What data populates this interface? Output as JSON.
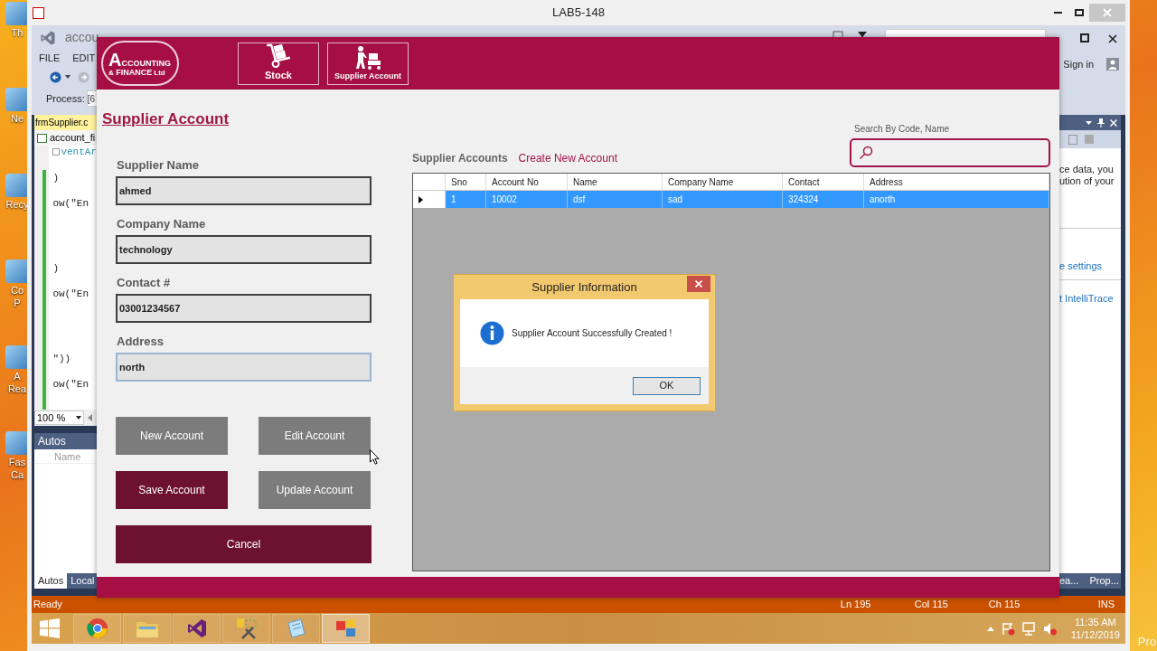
{
  "host_desktop": {
    "icons": [
      {
        "label": "Th"
      },
      {
        "label": "Ne"
      },
      {
        "label": "Recy"
      },
      {
        "label": "Co\nP"
      },
      {
        "label": "A\nRea"
      },
      {
        "label": "Fas\nCa"
      }
    ],
    "corner_text": "Pro"
  },
  "vm_window": {
    "title": "LAB5-148"
  },
  "ide": {
    "title": "accou",
    "menu": [
      "FILE",
      "EDIT"
    ],
    "sign_in": "Sign in",
    "process_label": "Process:",
    "process_value": "[6",
    "document_tab": "frmSupplier.c",
    "file_dropdown": "account_fi",
    "code_lines": [
      "ventAr",
      ")",
      "ow(\"En",
      ")",
      "ow(\"En",
      "\"))",
      "ow(\"En"
    ],
    "zoom": "100 %",
    "autos": {
      "title": "Autos",
      "column": "Name"
    },
    "bottom_tabs": [
      {
        "label": "Autos",
        "selected": true
      },
      {
        "label": "Local",
        "selected": false
      }
    ],
    "right_panel": {
      "lines": [
        "ce data, you",
        "ution of your"
      ],
      "links": [
        "e settings",
        "t IntelliTrace"
      ],
      "tabs": [
        "ea...",
        "Prop..."
      ]
    },
    "status_bar": {
      "state": "Ready",
      "line": "Ln 195",
      "column": "Col 115",
      "char": "Ch 115",
      "mode": "INS"
    }
  },
  "taskbar": {
    "apps": [
      {
        "kind": "chrome",
        "active": false
      },
      {
        "kind": "explorer",
        "active": false
      },
      {
        "kind": "visual-studio",
        "active": false
      },
      {
        "kind": "tools",
        "active": false
      },
      {
        "kind": "notepad",
        "active": false
      },
      {
        "kind": "windows-app",
        "active": true
      }
    ],
    "time": "11:35 AM",
    "date": "11/12/2019"
  },
  "app": {
    "logo": {
      "line_1": "ACCOUNTING",
      "symbol": "&",
      "line_2": "FINANCE",
      "suffix": "Ltd"
    },
    "nav": [
      {
        "kind": "stock",
        "label": "Stock"
      },
      {
        "kind": "supplier",
        "label": "Supplier Account"
      }
    ],
    "page_title": "Supplier Account",
    "fields": [
      {
        "label": "Supplier Name",
        "value": "ahmed",
        "focused": false
      },
      {
        "label": "Company Name",
        "value": "technology",
        "focused": false
      },
      {
        "label": "Contact #",
        "value": "03001234567",
        "focused": false
      },
      {
        "label": "Address",
        "value": "north",
        "focused": true
      }
    ],
    "buttons": [
      {
        "label": "New Account",
        "disabled": true
      },
      {
        "label": "Edit Account",
        "disabled": true
      },
      {
        "label": "Save Account",
        "disabled": false
      },
      {
        "label": "Update Account",
        "disabled": true
      },
      {
        "label": "Cancel",
        "disabled": false
      }
    ],
    "search": {
      "label": "Search By Code, Name"
    },
    "accounts": {
      "title": "Supplier Accounts",
      "link": "Create New Account",
      "columns": [
        "Sno",
        "Account No",
        "Name",
        "Company Name",
        "Contact",
        "Address"
      ],
      "rows": [
        {
          "cells": [
            "1",
            "10002",
            "dsf",
            "sad",
            "324324",
            "anorth"
          ],
          "selected": true
        }
      ]
    },
    "dialog": {
      "title": "Supplier Information",
      "message": "Supplier Account Successfully Created !",
      "button": "OK"
    }
  }
}
